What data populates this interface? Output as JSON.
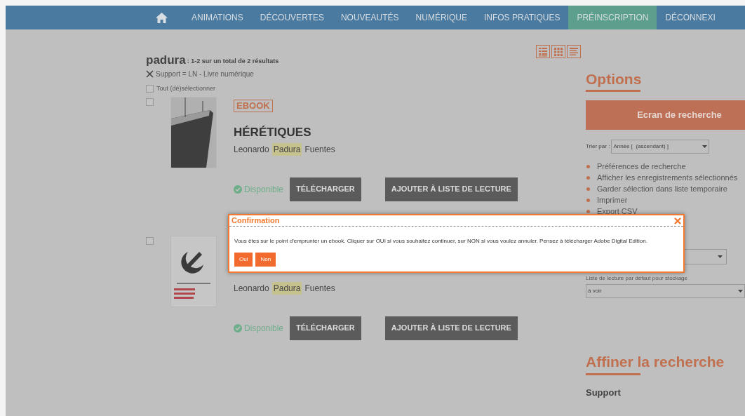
{
  "nav": {
    "items": [
      {
        "label": "ANIMATIONS",
        "selected": false
      },
      {
        "label": "DÉCOUVERTES",
        "selected": false
      },
      {
        "label": "NOUVEAUTÉS",
        "selected": false
      },
      {
        "label": "NUMÉRIQUE",
        "selected": false
      },
      {
        "label": "INFOS PRATIQUES",
        "selected": false
      },
      {
        "label": "PRÉINSCRIPTION",
        "selected": true
      },
      {
        "label": "DÉCONNEXI",
        "selected": false
      }
    ]
  },
  "search": {
    "query": "padura",
    "summary": ": 1-2 sur un total de 2 résultats",
    "filter": "Support = LN - Livre numérique",
    "select_all": {
      "label": "Tout (dé)sélectionner",
      "checked": false
    }
  },
  "results": [
    {
      "checked": false,
      "kind": "ship",
      "badge": "EBOOK",
      "title": "HÉRÉTIQUES",
      "author": [
        {
          "text": "Leonardo",
          "highlighted": false
        },
        {
          "text": "Padura",
          "highlighted": true
        },
        {
          "text": "Fuentes",
          "highlighted": false
        }
      ],
      "status": "Disponible",
      "buttons": [
        "TÉLÉCHARGER",
        "AJOUTER À LISTE DE LECTURE"
      ]
    },
    {
      "checked": false,
      "kind": "emblem",
      "author": [
        {
          "text": "Leonardo",
          "highlighted": false
        },
        {
          "text": "Padura",
          "highlighted": true
        },
        {
          "text": "Fuentes",
          "highlighted": false
        }
      ],
      "status": "Disponible",
      "buttons": [
        "TÉLÉCHARGER",
        "AJOUTER À LISTE DE LECTURE"
      ]
    }
  ],
  "sidebar": {
    "options_title": "Options",
    "search_button": "Ecran de recherche",
    "sort_label": "Trier par :",
    "sort_value": "Année [  (ascendant) ]",
    "links": [
      "Préférences de recherche",
      "Afficher les enregistrements sélectionnés",
      "Garder sélection dans liste temporaire",
      "Imprimer",
      "Export CSV"
    ],
    "reading_list_label": "Liste de lecture par défaut pour stockage",
    "reading_list_value": "à voir",
    "refine_title": "Affiner la recherche",
    "refine_section": "Support"
  },
  "dialog": {
    "title": "Confirmation",
    "message": "Vous êtes sur le point d'emprunter un ebook. Cliquer sur OUI si vous souhaitez continuer, sur NON si vous voulez annuler. Pensez à télécharger Adobe Digital Edition.",
    "buttons": [
      "Oui",
      "Non"
    ]
  }
}
